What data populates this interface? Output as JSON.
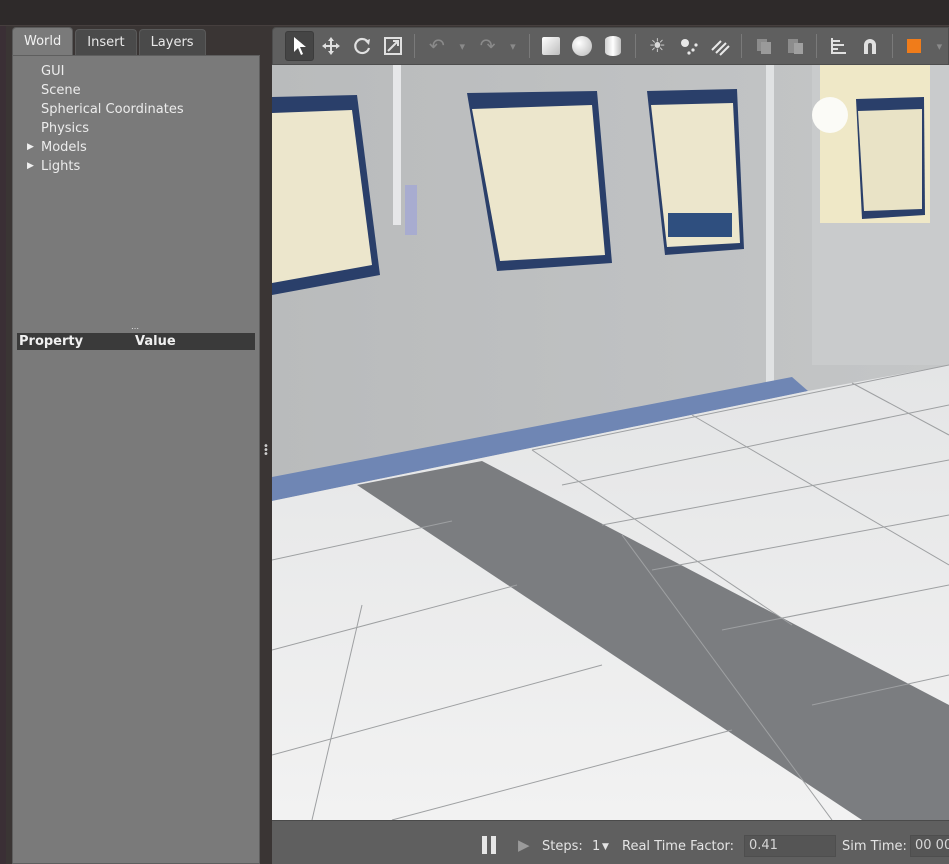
{
  "left_tabs": [
    {
      "label": "World",
      "active": true
    },
    {
      "label": "Insert",
      "active": false
    },
    {
      "label": "Layers",
      "active": false
    }
  ],
  "world_tree": [
    {
      "label": "GUI",
      "expandable": false
    },
    {
      "label": "Scene",
      "expandable": false
    },
    {
      "label": "Spherical Coordinates",
      "expandable": false
    },
    {
      "label": "Physics",
      "expandable": false
    },
    {
      "label": "Models",
      "expandable": true
    },
    {
      "label": "Lights",
      "expandable": true
    }
  ],
  "property_table": {
    "col_property": "Property",
    "col_value": "Value"
  },
  "toolbar": {
    "icons": [
      "select-arrow-icon",
      "translate-icon",
      "rotate-icon",
      "scale-icon",
      "undo-icon",
      "redo-icon",
      "box-shape-icon",
      "sphere-shape-icon",
      "cylinder-shape-icon",
      "point-light-icon",
      "spot-light-icon",
      "directional-light-icon",
      "copy-icon",
      "paste-icon",
      "align-icon",
      "snap-magnet-icon",
      "change-view-icon"
    ],
    "active_tool": "select-arrow-icon",
    "accent_color": "#f07c1a"
  },
  "bottom_bar": {
    "steps_label": "Steps:",
    "steps_value": "1",
    "rtf_label": "Real Time Factor:",
    "rtf_value": "0.41",
    "sim_time_label": "Sim Time:",
    "sim_time_value": "00 00"
  }
}
